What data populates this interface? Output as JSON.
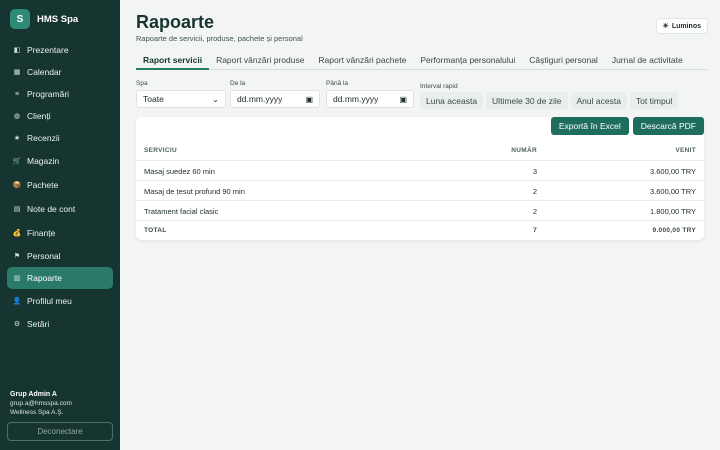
{
  "brand": {
    "logo_letter": "S",
    "name": "HMS Spa"
  },
  "sidebar": {
    "items": [
      {
        "label": "Prezentare",
        "icon": "layout-icon",
        "glyph": "◧"
      },
      {
        "label": "Calendar",
        "icon": "calendar-icon",
        "glyph": "▦"
      },
      {
        "label": "Programări",
        "icon": "list-icon",
        "glyph": "≡"
      },
      {
        "label": "Clienți",
        "icon": "user-circle-icon",
        "glyph": "◍"
      },
      {
        "label": "Recenzii",
        "icon": "star-icon",
        "glyph": "★"
      },
      {
        "label": "Magazin",
        "icon": "cart-icon",
        "glyph": "🛒"
      },
      {
        "label": "Pachete",
        "icon": "package-icon",
        "glyph": "📦"
      },
      {
        "label": "Note de cont",
        "icon": "document-icon",
        "glyph": "▤"
      },
      {
        "label": "Finanțe",
        "icon": "money-bag-icon",
        "glyph": "💰"
      },
      {
        "label": "Personal",
        "icon": "flag-icon",
        "glyph": "⚑"
      },
      {
        "label": "Rapoarte",
        "icon": "chart-icon",
        "glyph": "▥",
        "active": true
      },
      {
        "label": "Profilul meu",
        "icon": "person-icon",
        "glyph": "👤"
      },
      {
        "label": "Setări",
        "icon": "gear-icon",
        "glyph": "⚙"
      }
    ]
  },
  "user": {
    "name": "Grup Admin A",
    "email": "grup.a@hmsspa.com",
    "company": "Wellness Spa A.Ş.",
    "logout_label": "Deconectare"
  },
  "header": {
    "title": "Rapoarte",
    "subtitle": "Rapoarte de servicii, produse, pachete și personal",
    "theme_label": "Luminos",
    "theme_icon": "sun-icon"
  },
  "tabs": [
    {
      "label": "Raport servicii",
      "active": true
    },
    {
      "label": "Raport vânzări produse"
    },
    {
      "label": "Raport vânzări pachete"
    },
    {
      "label": "Performanța personalului"
    },
    {
      "label": "Câștiguri personal"
    },
    {
      "label": "Jurnal de activitate"
    }
  ],
  "filters": {
    "spa_label": "Spa",
    "spa_value": "Toate",
    "from_label": "De la",
    "from_placeholder": "dd.mm.yyyy",
    "to_label": "Până la",
    "to_placeholder": "dd.mm.yyyy",
    "quick_label": "Interval rapid",
    "quick_options": [
      "Luna aceasta",
      "Ultimele 30 de zile",
      "Anul acesta",
      "Tot timpul"
    ]
  },
  "actions": {
    "export_excel": "Exportă în Excel",
    "download_pdf": "Descarcă PDF"
  },
  "table": {
    "headers": {
      "service": "SERVICIU",
      "count": "NUMĂR",
      "revenue": "VENIT"
    },
    "rows": [
      {
        "service": "Masaj suedez 60 min",
        "count": "3",
        "revenue": "3.600,00 TRY"
      },
      {
        "service": "Masaj de țesut profund 90 min",
        "count": "2",
        "revenue": "3.600,00 TRY"
      },
      {
        "service": "Tratament facial clasic",
        "count": "2",
        "revenue": "1.800,00 TRY"
      }
    ],
    "total": {
      "label": "TOTAL",
      "count": "7",
      "revenue": "9.000,00 TRY"
    }
  }
}
